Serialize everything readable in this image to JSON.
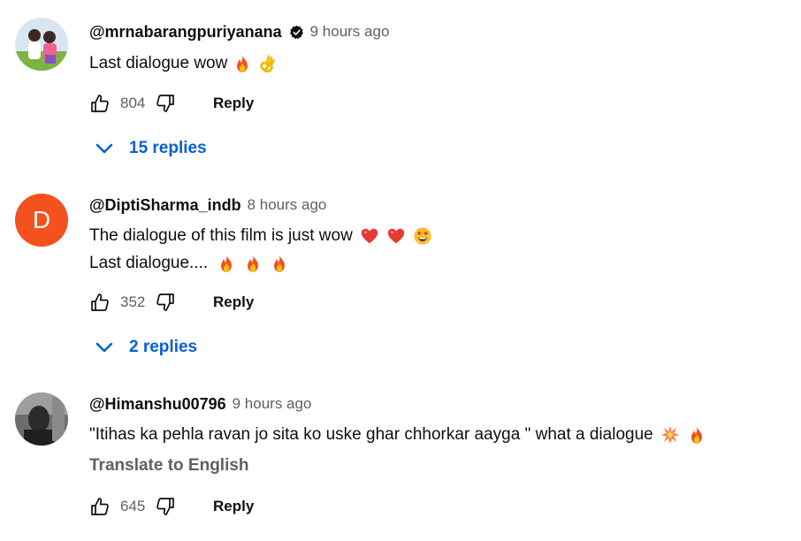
{
  "comments": [
    {
      "author": "@mrnabarangpuriyanana",
      "verified": true,
      "time": "9 hours ago",
      "lines": [
        "Last dialogue wow"
      ],
      "likes": "804",
      "reply_label": "Reply",
      "replies_label": "15 replies",
      "emoji": [
        "fire-emoji",
        "ok-hand-emoji"
      ]
    },
    {
      "author": "@DiptiSharma_indb",
      "avatar_letter": "D",
      "time": "8 hours ago",
      "lines": [
        "The dialogue of this film is just wow",
        "Last dialogue...."
      ],
      "likes": "352",
      "reply_label": "Reply",
      "replies_label": "2 replies",
      "emoji": [
        "red-heart-emoji",
        "red-heart-emoji",
        "star-struck-emoji",
        "fire-emoji",
        "fire-emoji",
        "fire-emoji"
      ]
    },
    {
      "author": "@Himanshu00796",
      "time": "9 hours ago",
      "lines": [
        "\"Itihas ka pehla ravan jo sita ko uske ghar chhorkar aayga \" what a dialogue"
      ],
      "translate_label": "Translate to English",
      "likes": "645",
      "reply_label": "Reply",
      "emoji": [
        "collision-emoji",
        "fire-emoji"
      ]
    }
  ],
  "colors": {
    "link_blue": "#065fd4",
    "avatar_orange": "#f4511e",
    "secondary_text": "#606060",
    "primary_text": "#0f0f0f"
  }
}
